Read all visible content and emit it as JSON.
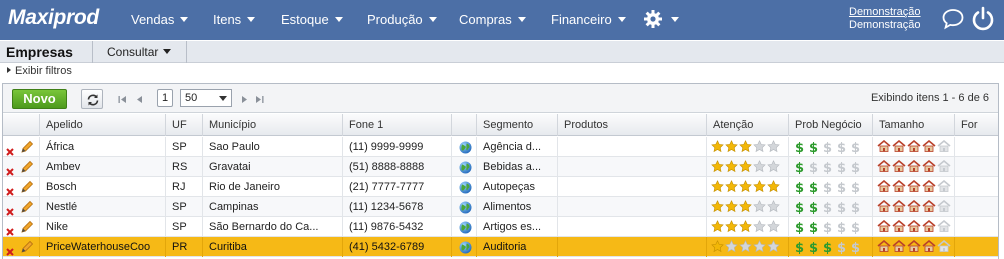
{
  "app": {
    "name": "Maxiprod"
  },
  "nav": {
    "items": [
      {
        "label": "Vendas"
      },
      {
        "label": "Itens"
      },
      {
        "label": "Estoque"
      },
      {
        "label": "Produção"
      },
      {
        "label": "Compras"
      },
      {
        "label": "Financeiro"
      }
    ],
    "settings_icon": "gear-icon",
    "user_line1": "Demonstração",
    "user_line2": "Demonstração",
    "chat_icon": "chat-bubble-icon",
    "power_icon": "power-icon"
  },
  "subheader": {
    "title": "Empresas",
    "consultar_label": "Consultar",
    "filters_label": "Exibir filtros"
  },
  "toolbar": {
    "new_label": "Novo",
    "current_page": "1",
    "page_size": "50",
    "info": "Exibindo itens 1 - 6 de 6"
  },
  "colors": {
    "nav_bg": "#4c6fa6",
    "new_button": "#5eab26",
    "selected_row": "#f6b916",
    "star": "#f2b707",
    "dollar": "#2e9b2e",
    "house": "#b9412a"
  },
  "table": {
    "columns": [
      "Apelido",
      "UF",
      "Município",
      "Fone 1",
      "Segmento",
      "Produtos",
      "Atenção",
      "Prob Negócio",
      "Tamanho",
      "For"
    ],
    "rows": [
      {
        "apelido": "África",
        "uf": "SP",
        "municipio": "Sao Paulo",
        "fone": "(11) 9999-9999",
        "segmento": "Agência d...",
        "produtos": "",
        "atencao": 3,
        "prob": 2,
        "tamanho": 4,
        "selected": false
      },
      {
        "apelido": "Ambev",
        "uf": "RS",
        "municipio": "Gravatai",
        "fone": "(51) 8888-8888",
        "segmento": "Bebidas a...",
        "produtos": "",
        "atencao": 3,
        "prob": 1,
        "tamanho": 4,
        "selected": false
      },
      {
        "apelido": "Bosch",
        "uf": "RJ",
        "municipio": "Rio de Janeiro",
        "fone": "(21) 7777-7777",
        "segmento": "Autopeças",
        "produtos": "",
        "atencao": 5,
        "prob": 2,
        "tamanho": 4,
        "selected": false
      },
      {
        "apelido": "Nestlé",
        "uf": "SP",
        "municipio": "Campinas",
        "fone": "(11) 1234-5678",
        "segmento": "Alimentos",
        "produtos": "",
        "atencao": 3,
        "prob": 2,
        "tamanho": 4,
        "selected": false
      },
      {
        "apelido": "Nike",
        "uf": "SP",
        "municipio": "São Bernardo do Ca...",
        "fone": "(11) 9876-5432",
        "segmento": "Artigos es...",
        "produtos": "",
        "atencao": 3,
        "prob": 2,
        "tamanho": 4,
        "selected": false
      },
      {
        "apelido": "PriceWaterhouseCoo",
        "uf": "PR",
        "municipio": "Curitiba",
        "fone": "(41) 5432-6789",
        "segmento": "Auditoria",
        "produtos": "",
        "atencao": 1,
        "prob": 3,
        "tamanho": 4,
        "selected": true
      }
    ]
  }
}
